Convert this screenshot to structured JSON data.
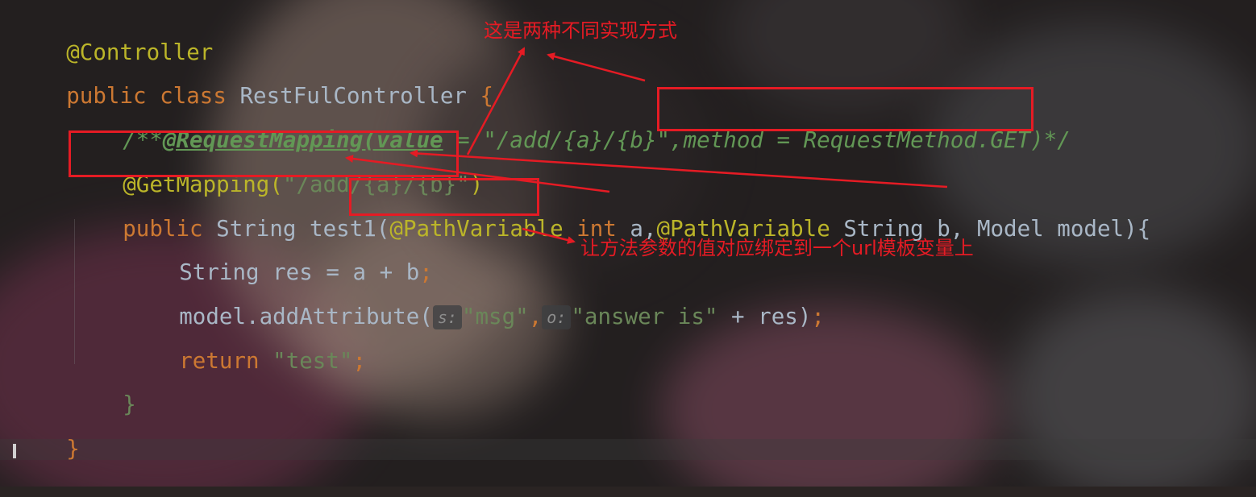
{
  "code": {
    "line1": {
      "annotation": "@Controller"
    },
    "line2": {
      "kw_public": "public",
      "kw_class": "class",
      "class_name": "RestFulController",
      "brace": "{"
    },
    "line3": {
      "comment_open": "/**",
      "comment_annotation": "@RequestMapping(value",
      "comment_mid": " = \"/add/{a}/{b}\",",
      "comment_method": "method = RequestMethod.GET",
      "comment_close": ")*/"
    },
    "line4": {
      "annotation": "@GetMapping(",
      "path": "\"/add/{a}/{b}\"",
      "close": ")"
    },
    "line5": {
      "kw_public": "public",
      "type": "String",
      "method": "test1(",
      "annotation1": "@PathVariable",
      "kw_int": "int",
      "param_a": "a,",
      "annotation2": "@PathVariable",
      "type_b": "String",
      "param_b": "b,",
      "type_model": "Model",
      "param_model": "model){"
    },
    "line6": {
      "text": "String res = a + b",
      "semicolon": ";"
    },
    "line7": {
      "prefix": "model.addAttribute(",
      "hint_s": "s:",
      "arg1": "\"msg\"",
      "comma": ",",
      "hint_o": "o:",
      "arg2": "\"answer is\"",
      "rest": " + res)",
      "semicolon": ";"
    },
    "line8": {
      "kw_return": "return",
      "str": "\"test\"",
      "semicolon": ";"
    },
    "line9": {
      "brace": "}"
    },
    "line10": {
      "brace": "}"
    }
  },
  "annotations": {
    "note_top": "这是两种不同实现方式",
    "note_bottom": "让方法参数的值对应绑定到一个url模板变量上"
  },
  "colors": {
    "keyword": "#cc7832",
    "annotation": "#bbb529",
    "string": "#6a8759",
    "comment": "#629755",
    "text": "#a9b7c6",
    "markup_red": "#e51b24"
  }
}
